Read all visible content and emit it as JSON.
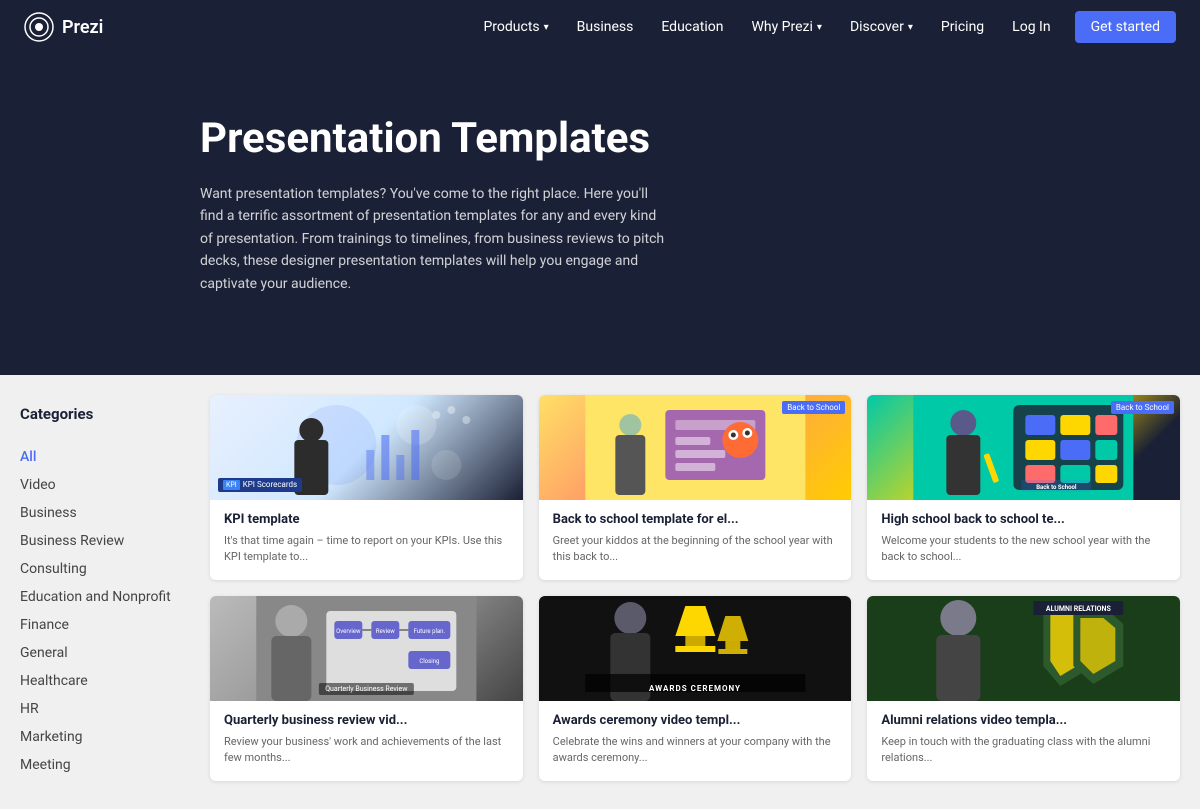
{
  "nav": {
    "logo_text": "Prezi",
    "links": [
      {
        "label": "Products",
        "has_dropdown": true
      },
      {
        "label": "Business",
        "has_dropdown": false
      },
      {
        "label": "Education",
        "has_dropdown": false
      },
      {
        "label": "Why Prezi",
        "has_dropdown": true
      },
      {
        "label": "Discover",
        "has_dropdown": true
      },
      {
        "label": "Pricing",
        "has_dropdown": false
      }
    ],
    "login_label": "Log In",
    "get_started_label": "Get started"
  },
  "hero": {
    "title": "Presentation Templates",
    "description": "Want presentation templates? You've come to the right place. Here you'll find a terrific assortment of presentation templates for any and every kind of presentation. From trainings to timelines, from business reviews to pitch decks, these designer presentation templates will help you engage and captivate your audience."
  },
  "sidebar": {
    "title": "Categories",
    "items": [
      {
        "label": "All",
        "active": true
      },
      {
        "label": "Video"
      },
      {
        "label": "Business"
      },
      {
        "label": "Business Review"
      },
      {
        "label": "Consulting"
      },
      {
        "label": "Education and Nonprofit"
      },
      {
        "label": "Finance"
      },
      {
        "label": "General"
      },
      {
        "label": "Healthcare"
      },
      {
        "label": "HR"
      },
      {
        "label": "Marketing"
      },
      {
        "label": "Meeting"
      }
    ]
  },
  "templates": [
    {
      "id": "kpi",
      "title": "KPI template",
      "description": "It's that time again – time to report on your KPIs. Use this KPI template to...",
      "badge": "KPI  Scorecards",
      "color_class": "card-kpi"
    },
    {
      "id": "back-to-school",
      "title": "Back to school template for el...",
      "description": "Greet your kiddos at the beginning of the school year with this back to...",
      "tag": "Back to School",
      "color_class": "card-school"
    },
    {
      "id": "high-school",
      "title": "High school back to school te...",
      "description": "Welcome your students to the new school year with the back to school...",
      "tag": "Back to School",
      "color_class": "card-highschool"
    },
    {
      "id": "quarterly-review",
      "title": "Quarterly business review vid...",
      "description": "Review your business' work and achievements of the last few months...",
      "color_class": "card-quarterly",
      "badge_text": "Quarterly Business Review"
    },
    {
      "id": "awards",
      "title": "Awards ceremony video templ...",
      "description": "Celebrate the wins and winners at your company with the awards ceremony...",
      "color_class": "card-awards",
      "badge_text": "AWARDS CEREMONY"
    },
    {
      "id": "alumni",
      "title": "Alumni relations video templa...",
      "description": "Keep in touch with the graduating class with the alumni relations...",
      "color_class": "card-alumni",
      "badge_text": "ALUMNI RELATIONS"
    }
  ]
}
